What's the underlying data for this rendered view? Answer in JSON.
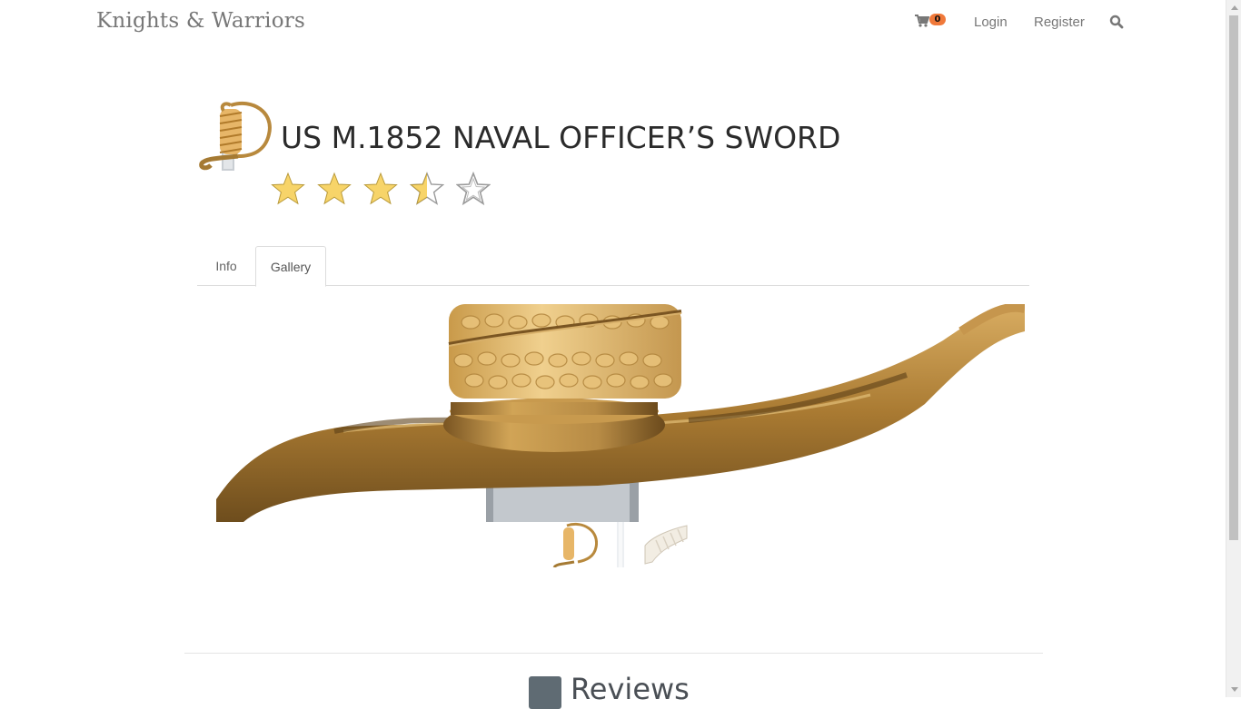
{
  "header": {
    "brand": "Knights & Warriors",
    "cart_count": "0",
    "login_label": "Login",
    "register_label": "Register"
  },
  "product": {
    "title": "US M.1852 NAVAL OFFICER’S SWORD",
    "rating": 3.5,
    "rating_max": 5
  },
  "tabs": [
    {
      "label": "Info",
      "active": false
    },
    {
      "label": "Gallery",
      "active": true
    }
  ],
  "sections": {
    "reviews_title": "Reviews"
  },
  "icons": {
    "cart": "cart-icon",
    "search": "search-icon",
    "star_filled": "star-icon",
    "reviews": "comment-icon"
  },
  "colors": {
    "badge": "#f0793a",
    "star_fill": "#f7d469",
    "brass": "#b8893d"
  }
}
